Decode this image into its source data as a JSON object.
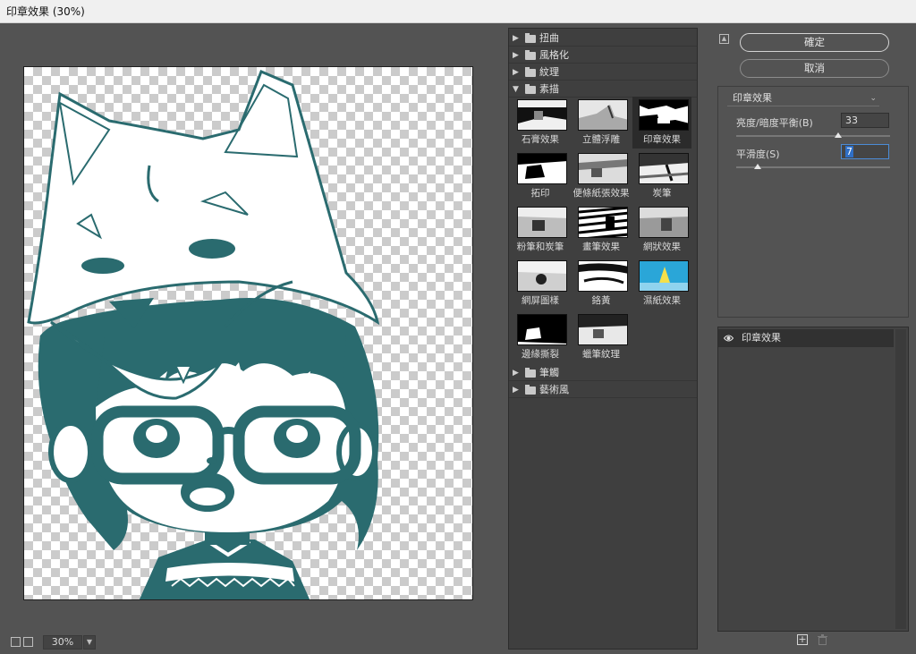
{
  "window": {
    "title": "印章效果 (30%)"
  },
  "preview": {
    "zoom": "30%"
  },
  "gallery": {
    "categories_top": [
      {
        "label": "扭曲",
        "expanded": false
      },
      {
        "label": "風格化",
        "expanded": false
      },
      {
        "label": "紋理",
        "expanded": false
      },
      {
        "label": "素描",
        "expanded": true
      }
    ],
    "sketch_filters": [
      {
        "label": "石膏效果"
      },
      {
        "label": "立體浮雕"
      },
      {
        "label": "印章效果",
        "selected": true
      },
      {
        "label": "拓印"
      },
      {
        "label": "便條紙張效果"
      },
      {
        "label": "炭筆"
      },
      {
        "label": "粉筆和炭筆"
      },
      {
        "label": "畫筆效果"
      },
      {
        "label": "網狀效果"
      },
      {
        "label": "網屏圖樣"
      },
      {
        "label": "鉻黃"
      },
      {
        "label": "濕紙效果"
      },
      {
        "label": "邊緣撕裂"
      },
      {
        "label": "蠟筆紋理"
      }
    ],
    "categories_bottom": [
      {
        "label": "筆觸",
        "expanded": false
      },
      {
        "label": "藝術風",
        "expanded": false
      }
    ]
  },
  "buttons": {
    "ok": "確定",
    "cancel": "取消"
  },
  "settings": {
    "filter_name": "印章效果",
    "light_dark_balance": {
      "label": "亮度/暗度平衡(B)",
      "value": "33",
      "level": 0.66
    },
    "smoothness": {
      "label": "平滑度(S)",
      "value": "7",
      "level": 0.14
    }
  },
  "layers": {
    "items": [
      {
        "name": "印章效果"
      }
    ]
  },
  "colors": {
    "accent_teal": "#2a6b6f",
    "panel_bg": "#535353",
    "selection_blue": "#2f6fc6"
  }
}
